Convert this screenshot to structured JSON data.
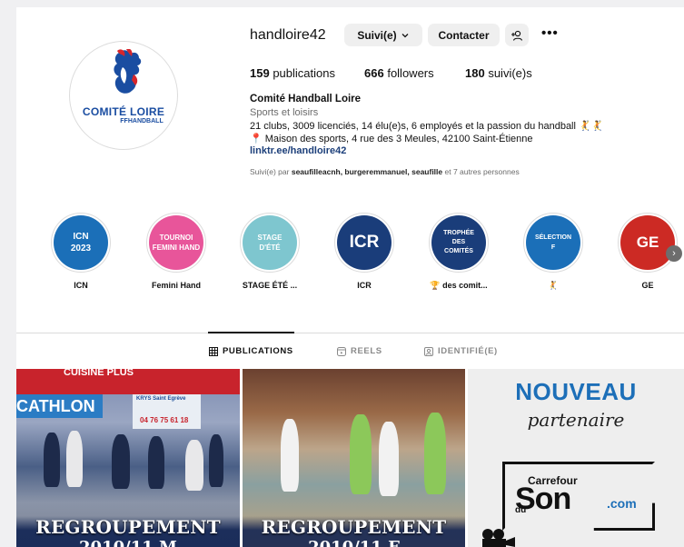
{
  "profile": {
    "username": "handloire42",
    "follow_label": "Suivi(e)",
    "contact_label": "Contacter",
    "more_label": "•••",
    "logo_title": "COMITÉ LOIRE",
    "logo_subtitle": "FFHANDBALL"
  },
  "stats": {
    "posts_count": "159",
    "posts_label": "publications",
    "followers_count": "666",
    "followers_label": "followers",
    "following_count": "180",
    "following_label": "suivi(e)s"
  },
  "bio": {
    "name": "Comité Handball Loire",
    "category": "Sports et loisirs",
    "line1": "21 clubs, 3009 licenciés, 14 élu(e)s, 6 employés et la passion du handball 🤾🤾",
    "line2": "📍 Maison des sports, 4 rue des 3 Meules, 42100 Saint-Étienne",
    "link": "linktr.ee/handloire42",
    "followed_prefix": "Suivi(e) par",
    "followed_users": "seaufilleacnh, burgeremmanuel, seaufille",
    "followed_suffix": "et 7 autres personnes"
  },
  "highlights": [
    {
      "cover": "ICN\n2023",
      "label": "ICN",
      "color": "#1b6fb8"
    },
    {
      "cover": "TOURNOI\nFEMINI HAND",
      "label": "Femini Hand",
      "color": "#e8559a"
    },
    {
      "cover": "STAGE\nD'ÉTÉ",
      "label": "STAGE ÉTÉ ...",
      "color": "#7ec6cf"
    },
    {
      "cover": "ICR",
      "label": "ICR",
      "color": "#1a3d7a"
    },
    {
      "cover": "TROPHÉE\nDES\nCOMITÉS",
      "label": "🏆 des comit...",
      "color": "#1a3d7a"
    },
    {
      "cover": "SÉLECTION\nF",
      "label": "🤾",
      "color": "#1b6fb8"
    },
    {
      "cover": "GE",
      "label": "GE",
      "color": "#cc2a24"
    }
  ],
  "tabs": [
    {
      "label": "PUBLICATIONS",
      "icon": "grid-icon",
      "active": true
    },
    {
      "label": "REELS",
      "icon": "reels-icon",
      "active": false
    },
    {
      "label": "IDENTIFIÉ(E)",
      "icon": "tagged-icon",
      "active": false
    }
  ],
  "posts": [
    {
      "title": "REGROUPEMENT",
      "subtitle": "2010/11 M",
      "sign1": "CATHLON",
      "sign2": "KRYS Saint Egrève",
      "sign3": "04 76 75 61 18",
      "sign4": "CUISINE PLUS"
    },
    {
      "title": "REGROUPEMENT",
      "subtitle": "2010/11 F"
    },
    {
      "headline": "NOUVEAU",
      "script": "partenaire",
      "brand_top": "Carrefour",
      "brand_main": "Son",
      "brand_du": "du",
      "brand_domain": ".com"
    }
  ],
  "colors": {
    "accent": "#1c3f7a",
    "muted": "#6b6b6b",
    "button_bg": "#efefef"
  }
}
